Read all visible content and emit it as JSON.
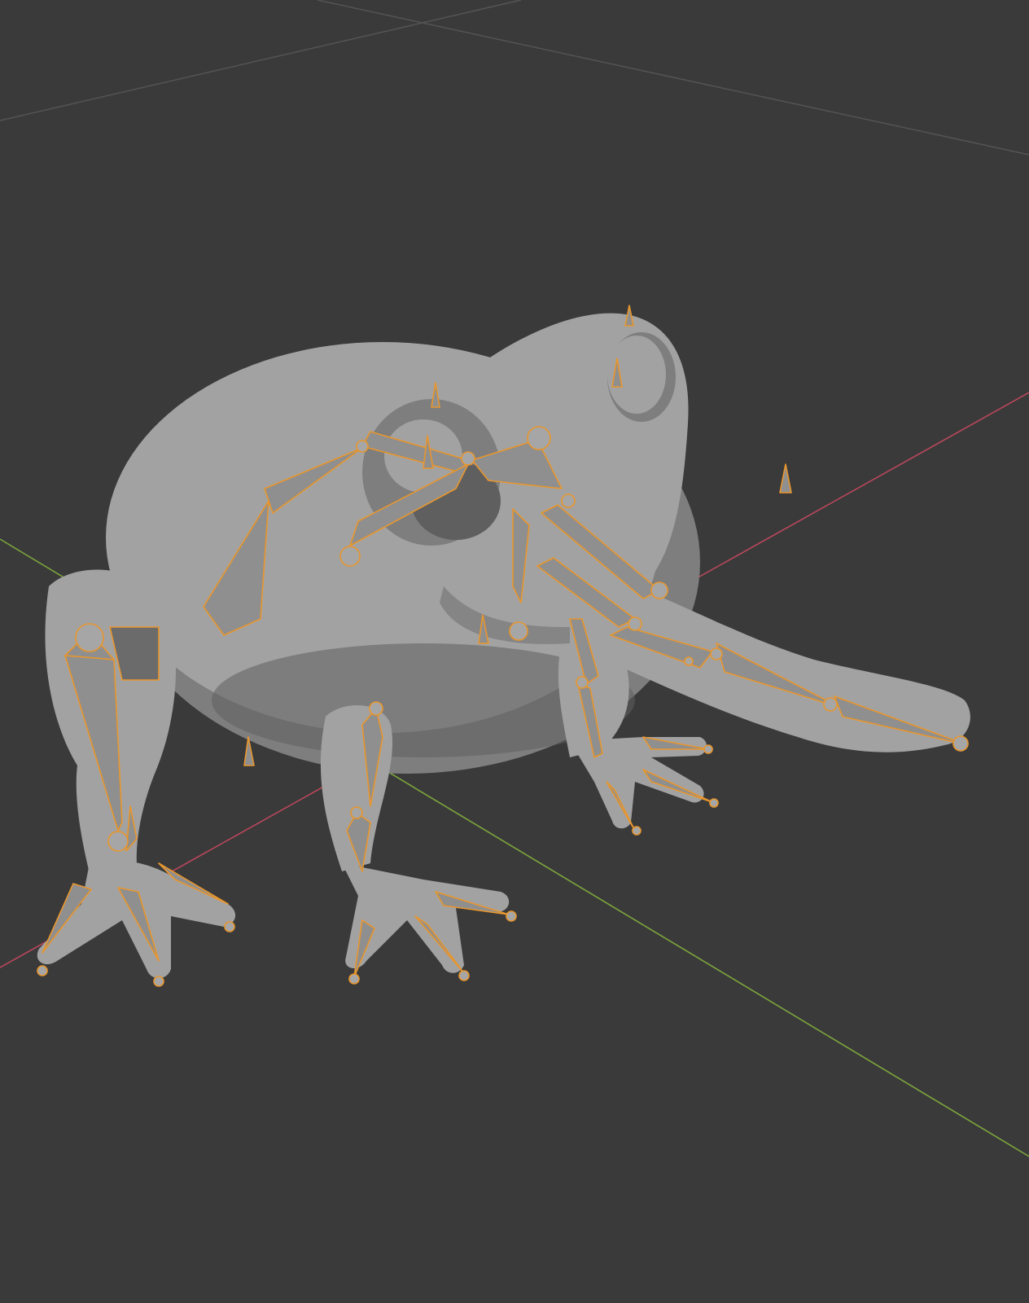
{
  "viewport": {
    "background": "#3a3a3a",
    "x_axis_color": "#b9475b",
    "y_axis_color": "#7da63c",
    "grid_line_color": "#545454"
  },
  "scene": {
    "object": "frog-mesh",
    "armature": "frog-armature",
    "mesh_color": "#a2a2a2",
    "bone_fill": "#8f8f8f",
    "bone_outline_color": "#e8962d",
    "mode": "edit-armature"
  }
}
